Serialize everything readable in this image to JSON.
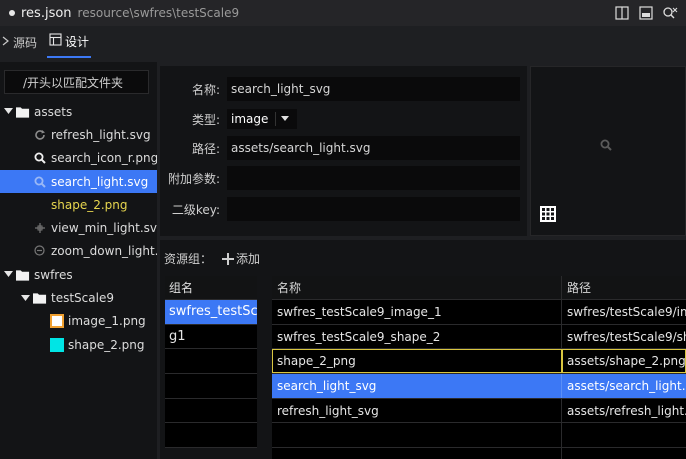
{
  "titlebar": {
    "file": "res.json",
    "path": "resource\\swfres\\testScale9",
    "icons": [
      "split-editor-icon",
      "toggle-panel-icon",
      "compare-search-icon"
    ]
  },
  "tabs": [
    {
      "label": "源码",
      "icon": "chevron-right-icon",
      "active": false
    },
    {
      "label": "设计",
      "icon": "layout-icon",
      "active": true
    }
  ],
  "tree": {
    "filter_value": "/开头以匹配文件夹",
    "items": [
      {
        "label": "assets",
        "type": "folder",
        "level": 0,
        "expanded": true
      },
      {
        "label": "refresh_light.svg",
        "type": "file",
        "icon": "refresh-icon",
        "level": 1
      },
      {
        "label": "search_icon_r.png",
        "type": "file",
        "icon": "search-icon",
        "level": 1
      },
      {
        "label": "search_light.svg",
        "type": "file",
        "icon": "search-icon",
        "level": 1,
        "selected": true
      },
      {
        "label": "shape_2.png",
        "type": "file",
        "icon": "none",
        "level": 1,
        "modified": true
      },
      {
        "label": "view_min_light.svg",
        "type": "file",
        "icon": "move-icon",
        "level": 1
      },
      {
        "label": "zoom_down_light.svg",
        "type": "file",
        "icon": "zoom-out-icon",
        "level": 1
      },
      {
        "label": "swfres",
        "type": "folder",
        "level": 0,
        "expanded": true
      },
      {
        "label": "testScale9",
        "type": "folder",
        "level": 1,
        "expanded": true
      },
      {
        "label": "image_1.png",
        "type": "file",
        "icon": "image-swatch-icon",
        "level": 2
      },
      {
        "label": "shape_2.png",
        "type": "file",
        "icon": "shape-swatch-icon",
        "level": 2
      }
    ]
  },
  "props": {
    "name_label": "名称:",
    "name_value": "search_light_svg",
    "type_label": "类型:",
    "type_value": "image",
    "path_label": "路径:",
    "path_value": "assets/search_light.svg",
    "extra_label": "附加参数:",
    "extra_value": "",
    "subkey_label": "二级key:",
    "subkey_value": ""
  },
  "groups": {
    "header_label": "资源组：",
    "add_label": "添加",
    "column": "组名",
    "rows": [
      "swfres_testSc",
      "g1"
    ],
    "selected_index": 0
  },
  "resources": {
    "col_name": "名称",
    "col_path": "路径",
    "rows": [
      {
        "name": "swfres_testScale9_image_1",
        "path": "swfres/testScale9/im"
      },
      {
        "name": "swfres_testScale9_shape_2",
        "path": "swfres/testScale9/sh"
      },
      {
        "name": "shape_2_png",
        "path": "assets/shape_2.png",
        "modified": true
      },
      {
        "name": "search_light_svg",
        "path": "assets/search_light.s",
        "selected": true
      },
      {
        "name": "refresh_light_svg",
        "path": "assets/refresh_light.s"
      }
    ]
  },
  "colors": {
    "accent": "#3c78f5",
    "modified": "#e7d64f",
    "image_swatch": "#f0a030",
    "shape_swatch": "#00e5e5"
  }
}
